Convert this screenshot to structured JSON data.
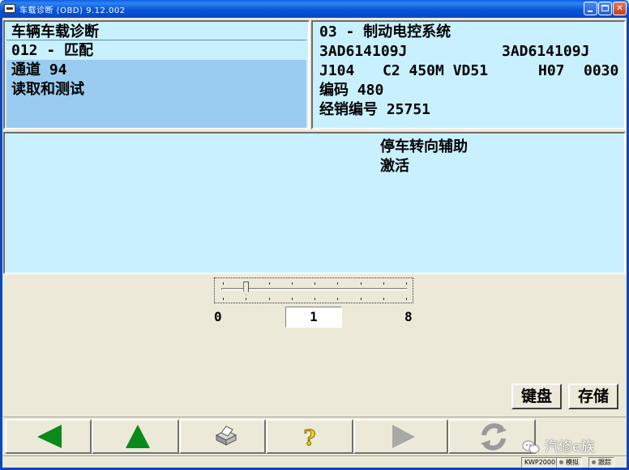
{
  "window": {
    "title": "车载诊断 (OBD)  9.12.002"
  },
  "left_panel": {
    "line1": "车辆车载诊断",
    "line2": "012 - 匹配",
    "line3": "通道 94",
    "line4": "读取和测试"
  },
  "right_panel": {
    "system": "03 - 制动电控系统",
    "part_no_1": "3AD614109J",
    "part_no_2": "3AD614109J",
    "component": "J104",
    "c2": "C2 450M VD51",
    "h07": "H07",
    "code0030": "0030",
    "coding": "编码 480",
    "dealer": "经销编号 25751"
  },
  "display": {
    "line1": "停车转向辅助",
    "line2": "激活"
  },
  "slider": {
    "min_label": "0",
    "max_label": "8",
    "value": "1",
    "min": 0,
    "max": 8,
    "current": 1
  },
  "buttons": {
    "keyboard": "键盘",
    "save": "存储"
  },
  "toolbar": {
    "icons": [
      "arrow-left-icon",
      "arrow-up-icon",
      "printer-icon",
      "help-icon",
      "arrow-right-icon",
      "refresh-icon"
    ]
  },
  "watermark": {
    "text": "汽修e族"
  },
  "status_bar": {
    "item1": "KWP2000",
    "item2": "模拟",
    "item3": "跟踪"
  },
  "colors": {
    "panel_bg": "#c8f0ff",
    "highlight": "#99ccf0",
    "green_arrow": "#0a8a1a",
    "title_bar": "#0a55d9"
  }
}
